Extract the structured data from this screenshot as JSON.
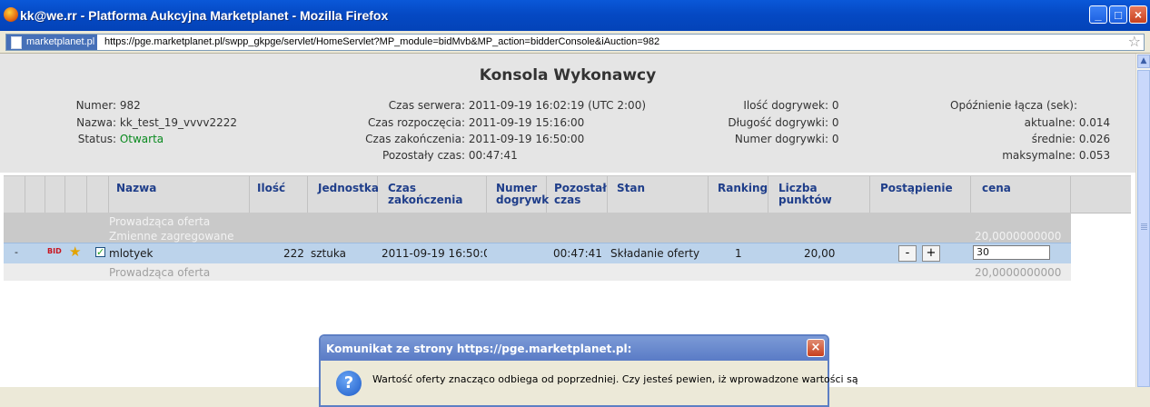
{
  "window": {
    "title": "kk@we.rr - Platforma Aukcyjna Marketplanet - Mozilla Firefox",
    "minimize": "_",
    "maximize": "□",
    "close": "×"
  },
  "urlbar": {
    "site": "marketplanet.pl",
    "url": "https://pge.marketplanet.pl/swpp_gkpge/servlet/HomeServlet?MP_module=bidMvb&MP_action=bidderConsole&iAuction=982",
    "bookmark_star": "☆"
  },
  "page": {
    "title": "Konsola Wykonawcy"
  },
  "info": {
    "numer_label": "Numer:",
    "numer": "982",
    "nazwa_label": "Nazwa:",
    "nazwa": "kk_test_19_vvvv2222",
    "status_label": "Status:",
    "status": "Otwarta",
    "czas_serwera_label": "Czas serwera:",
    "czas_serwera": "2011-09-19 16:02:19 (UTC 2:00)",
    "czas_rozpoczecia_label": "Czas rozpoczęcia:",
    "czas_rozpoczecia": "2011-09-19 15:16:00",
    "czas_zakonczenia_label": "Czas zakończenia:",
    "czas_zakonczenia": "2011-09-19 16:50:00",
    "pozostaly_label": "Pozostały czas:",
    "pozostaly": "00:47:41",
    "ilosc_dogrywek_label": "Ilość dogrywek:",
    "ilosc_dogrywek": "0",
    "dlugosc_dogrywki_label": "Długość dogrywki:",
    "dlugosc_dogrywki": "0",
    "numer_dogrywki_label": "Numer dogrywki:",
    "numer_dogrywki": "0",
    "opoznienie_label": "Opóźnienie łącza (sek):",
    "aktualne_label": "aktualne:",
    "aktualne": "0.014",
    "srednie_label": "średnie:",
    "srednie": "0.026",
    "maksymalne_label": "maksymalne:",
    "maksymalne": "0.053"
  },
  "table": {
    "headers": {
      "nazwa": "Nazwa",
      "ilosc": "Ilość",
      "jednostka": "Jednostka",
      "czas_zak_line1": "Czas zakończenia",
      "numer_dogr_line1": "Numer",
      "numer_dogr_line2": "dogrywk",
      "pozostaly_line1": "Pozostał",
      "pozostaly_line2": "czas",
      "stan": "Stan",
      "ranking": "Ranking",
      "punkty": "Liczba punktów",
      "postapienie": "Postąpienie",
      "cena": "cena"
    },
    "group_leading": "Prowadząca oferta",
    "group_vars": "Zmienne zagregowane",
    "group_vars_value": "20,0000000000",
    "row": {
      "expand": "-",
      "bid_badge": "BID",
      "nazwa": "mlotyek",
      "ilosc": "222",
      "jednostka": "sztuka",
      "czas_zak": "2011-09-19 16:50:0(",
      "pozostaly": "00:47:41",
      "stan": "Składanie oferty",
      "ranking": "1",
      "punkty": "20,00",
      "minus": "-",
      "plus": "+",
      "cena_input": "30"
    },
    "leading_row": {
      "label": "Prowadząca oferta",
      "value": "20,0000000000"
    }
  },
  "dialog": {
    "title": "Komunikat ze strony https://pge.marketplanet.pl:",
    "close": "×",
    "icon": "?",
    "message": "Wartość oferty znacząco odbiega od poprzedniej. Czy jesteś pewien, iż wprowadzone wartości są"
  }
}
